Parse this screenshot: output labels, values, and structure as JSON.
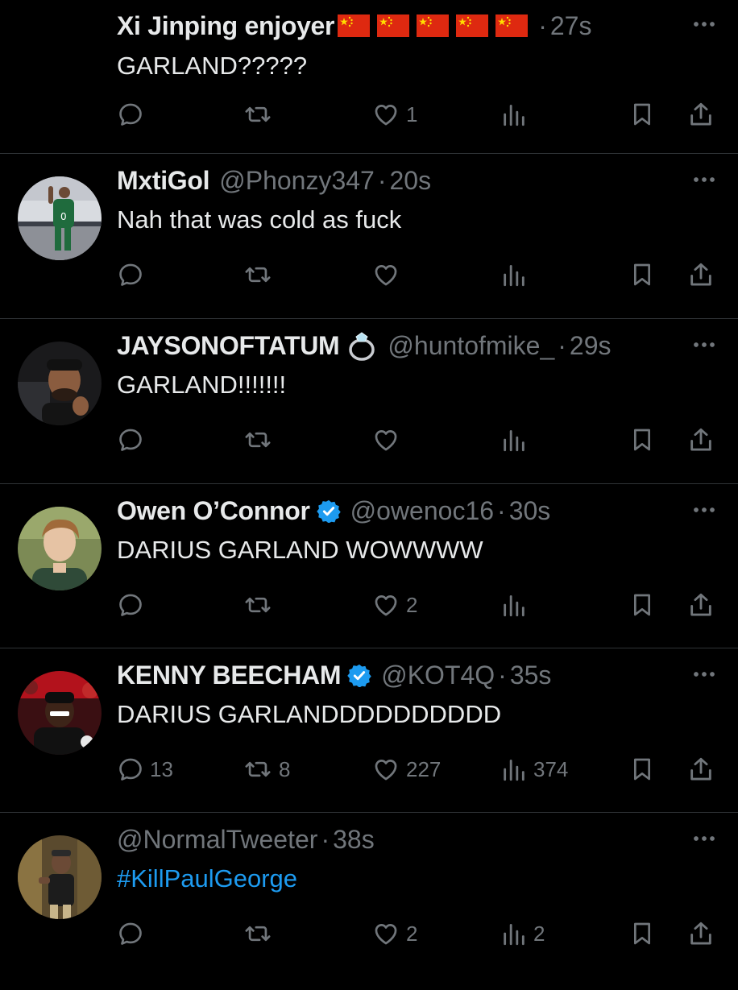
{
  "tweets": [
    {
      "display_name": "Xi Jinping enjoyer",
      "handle": "",
      "time": "27s",
      "text": "GARLAND?????",
      "flags": 5,
      "replies": "",
      "retweets": "",
      "likes": "1",
      "views": ""
    },
    {
      "display_name": "MxtiGol",
      "handle": "@Phonzy347",
      "time": "20s",
      "text": "Nah that was cold as fuck",
      "replies": "",
      "retweets": "",
      "likes": "",
      "views": ""
    },
    {
      "display_name": "JAYSONOFTATUM",
      "handle": "@huntofmike_",
      "time": "29s",
      "text": "GARLAND!!!!!!!",
      "replies": "",
      "retweets": "",
      "likes": "",
      "views": ""
    },
    {
      "display_name": "Owen O’Connor",
      "handle": "@owenoc16",
      "time": "30s",
      "text": "DARIUS GARLAND WOWWWW",
      "verified": true,
      "replies": "",
      "retweets": "",
      "likes": "2",
      "views": ""
    },
    {
      "display_name": "KENNY BEECHAM",
      "handle": "@KOT4Q",
      "time": "35s",
      "text": "DARIUS GARLANDDDDDDDDDD",
      "verified": true,
      "replies": "13",
      "retweets": "8",
      "likes": "227",
      "views": "374"
    },
    {
      "display_name": "",
      "handle": "@NormalTweeter",
      "time": "38s",
      "text": "#KillPaulGeorge",
      "replies": "",
      "retweets": "",
      "likes": "2",
      "views": "2"
    }
  ],
  "separator": "·",
  "icons": {
    "reply": "reply-icon",
    "retweet": "retweet-icon",
    "like": "heart-icon",
    "views": "views-icon",
    "bookmark": "bookmark-icon",
    "share": "share-icon",
    "more": "more-icon",
    "verified": "verified-badge-icon",
    "ring": "ring-emoji-icon",
    "flag": "china-flag-emoji-icon"
  },
  "colors": {
    "background": "#000000",
    "text": "#e7e9ea",
    "muted": "#71767b",
    "divider": "#2f3336",
    "link": "#1d9bf0",
    "verified": "#1d9bf0"
  }
}
